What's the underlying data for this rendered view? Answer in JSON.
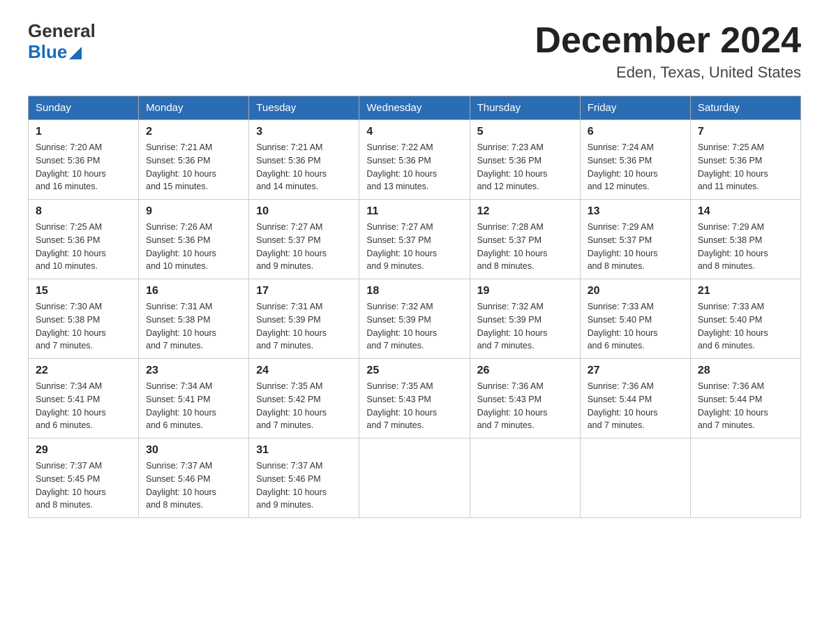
{
  "header": {
    "logo": {
      "general": "General",
      "blue": "Blue"
    },
    "title": "December 2024",
    "subtitle": "Eden, Texas, United States"
  },
  "weekdays": [
    "Sunday",
    "Monday",
    "Tuesday",
    "Wednesday",
    "Thursday",
    "Friday",
    "Saturday"
  ],
  "weeks": [
    [
      {
        "day": "1",
        "sunrise": "7:20 AM",
        "sunset": "5:36 PM",
        "daylight": "10 hours and 16 minutes."
      },
      {
        "day": "2",
        "sunrise": "7:21 AM",
        "sunset": "5:36 PM",
        "daylight": "10 hours and 15 minutes."
      },
      {
        "day": "3",
        "sunrise": "7:21 AM",
        "sunset": "5:36 PM",
        "daylight": "10 hours and 14 minutes."
      },
      {
        "day": "4",
        "sunrise": "7:22 AM",
        "sunset": "5:36 PM",
        "daylight": "10 hours and 13 minutes."
      },
      {
        "day": "5",
        "sunrise": "7:23 AM",
        "sunset": "5:36 PM",
        "daylight": "10 hours and 12 minutes."
      },
      {
        "day": "6",
        "sunrise": "7:24 AM",
        "sunset": "5:36 PM",
        "daylight": "10 hours and 12 minutes."
      },
      {
        "day": "7",
        "sunrise": "7:25 AM",
        "sunset": "5:36 PM",
        "daylight": "10 hours and 11 minutes."
      }
    ],
    [
      {
        "day": "8",
        "sunrise": "7:25 AM",
        "sunset": "5:36 PM",
        "daylight": "10 hours and 10 minutes."
      },
      {
        "day": "9",
        "sunrise": "7:26 AM",
        "sunset": "5:36 PM",
        "daylight": "10 hours and 10 minutes."
      },
      {
        "day": "10",
        "sunrise": "7:27 AM",
        "sunset": "5:37 PM",
        "daylight": "10 hours and 9 minutes."
      },
      {
        "day": "11",
        "sunrise": "7:27 AM",
        "sunset": "5:37 PM",
        "daylight": "10 hours and 9 minutes."
      },
      {
        "day": "12",
        "sunrise": "7:28 AM",
        "sunset": "5:37 PM",
        "daylight": "10 hours and 8 minutes."
      },
      {
        "day": "13",
        "sunrise": "7:29 AM",
        "sunset": "5:37 PM",
        "daylight": "10 hours and 8 minutes."
      },
      {
        "day": "14",
        "sunrise": "7:29 AM",
        "sunset": "5:38 PM",
        "daylight": "10 hours and 8 minutes."
      }
    ],
    [
      {
        "day": "15",
        "sunrise": "7:30 AM",
        "sunset": "5:38 PM",
        "daylight": "10 hours and 7 minutes."
      },
      {
        "day": "16",
        "sunrise": "7:31 AM",
        "sunset": "5:38 PM",
        "daylight": "10 hours and 7 minutes."
      },
      {
        "day": "17",
        "sunrise": "7:31 AM",
        "sunset": "5:39 PM",
        "daylight": "10 hours and 7 minutes."
      },
      {
        "day": "18",
        "sunrise": "7:32 AM",
        "sunset": "5:39 PM",
        "daylight": "10 hours and 7 minutes."
      },
      {
        "day": "19",
        "sunrise": "7:32 AM",
        "sunset": "5:39 PM",
        "daylight": "10 hours and 7 minutes."
      },
      {
        "day": "20",
        "sunrise": "7:33 AM",
        "sunset": "5:40 PM",
        "daylight": "10 hours and 6 minutes."
      },
      {
        "day": "21",
        "sunrise": "7:33 AM",
        "sunset": "5:40 PM",
        "daylight": "10 hours and 6 minutes."
      }
    ],
    [
      {
        "day": "22",
        "sunrise": "7:34 AM",
        "sunset": "5:41 PM",
        "daylight": "10 hours and 6 minutes."
      },
      {
        "day": "23",
        "sunrise": "7:34 AM",
        "sunset": "5:41 PM",
        "daylight": "10 hours and 6 minutes."
      },
      {
        "day": "24",
        "sunrise": "7:35 AM",
        "sunset": "5:42 PM",
        "daylight": "10 hours and 7 minutes."
      },
      {
        "day": "25",
        "sunrise": "7:35 AM",
        "sunset": "5:43 PM",
        "daylight": "10 hours and 7 minutes."
      },
      {
        "day": "26",
        "sunrise": "7:36 AM",
        "sunset": "5:43 PM",
        "daylight": "10 hours and 7 minutes."
      },
      {
        "day": "27",
        "sunrise": "7:36 AM",
        "sunset": "5:44 PM",
        "daylight": "10 hours and 7 minutes."
      },
      {
        "day": "28",
        "sunrise": "7:36 AM",
        "sunset": "5:44 PM",
        "daylight": "10 hours and 7 minutes."
      }
    ],
    [
      {
        "day": "29",
        "sunrise": "7:37 AM",
        "sunset": "5:45 PM",
        "daylight": "10 hours and 8 minutes."
      },
      {
        "day": "30",
        "sunrise": "7:37 AM",
        "sunset": "5:46 PM",
        "daylight": "10 hours and 8 minutes."
      },
      {
        "day": "31",
        "sunrise": "7:37 AM",
        "sunset": "5:46 PM",
        "daylight": "10 hours and 9 minutes."
      },
      null,
      null,
      null,
      null
    ]
  ],
  "labels": {
    "sunrise": "Sunrise:",
    "sunset": "Sunset:",
    "daylight": "Daylight:"
  }
}
